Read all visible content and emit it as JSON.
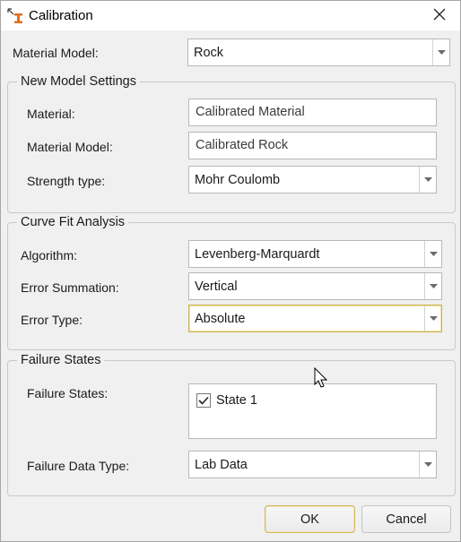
{
  "window": {
    "title": "Calibration",
    "app_icon": "calibration-app-icon",
    "close_icon": "close-icon"
  },
  "material_model": {
    "label": "Material Model:",
    "value": "Rock"
  },
  "new_model_settings": {
    "title": "New Model Settings",
    "material": {
      "label": "Material:",
      "value": "Calibrated Material"
    },
    "material_model": {
      "label": "Material Model:",
      "value": "Calibrated Rock"
    },
    "strength_type": {
      "label": "Strength type:",
      "value": "Mohr Coulomb"
    }
  },
  "curve_fit_analysis": {
    "title": "Curve Fit Analysis",
    "algorithm": {
      "label": "Algorithm:",
      "value": "Levenberg-Marquardt"
    },
    "error_summation": {
      "label": "Error Summation:",
      "value": "Vertical"
    },
    "error_type": {
      "label": "Error Type:",
      "value": "Absolute"
    }
  },
  "failure_states": {
    "title": "Failure States",
    "states": {
      "label": "Failure States:",
      "items": [
        {
          "label": "State 1",
          "checked": true
        }
      ]
    },
    "failure_data_type": {
      "label": "Failure Data Type:",
      "value": "Lab Data"
    }
  },
  "buttons": {
    "ok": "OK",
    "cancel": "Cancel"
  },
  "colors": {
    "focus_border": "#cdb24e",
    "dialog_bg": "#f0f0f0",
    "field_bg": "#ffffff",
    "icon_orange": "#e0701f"
  }
}
